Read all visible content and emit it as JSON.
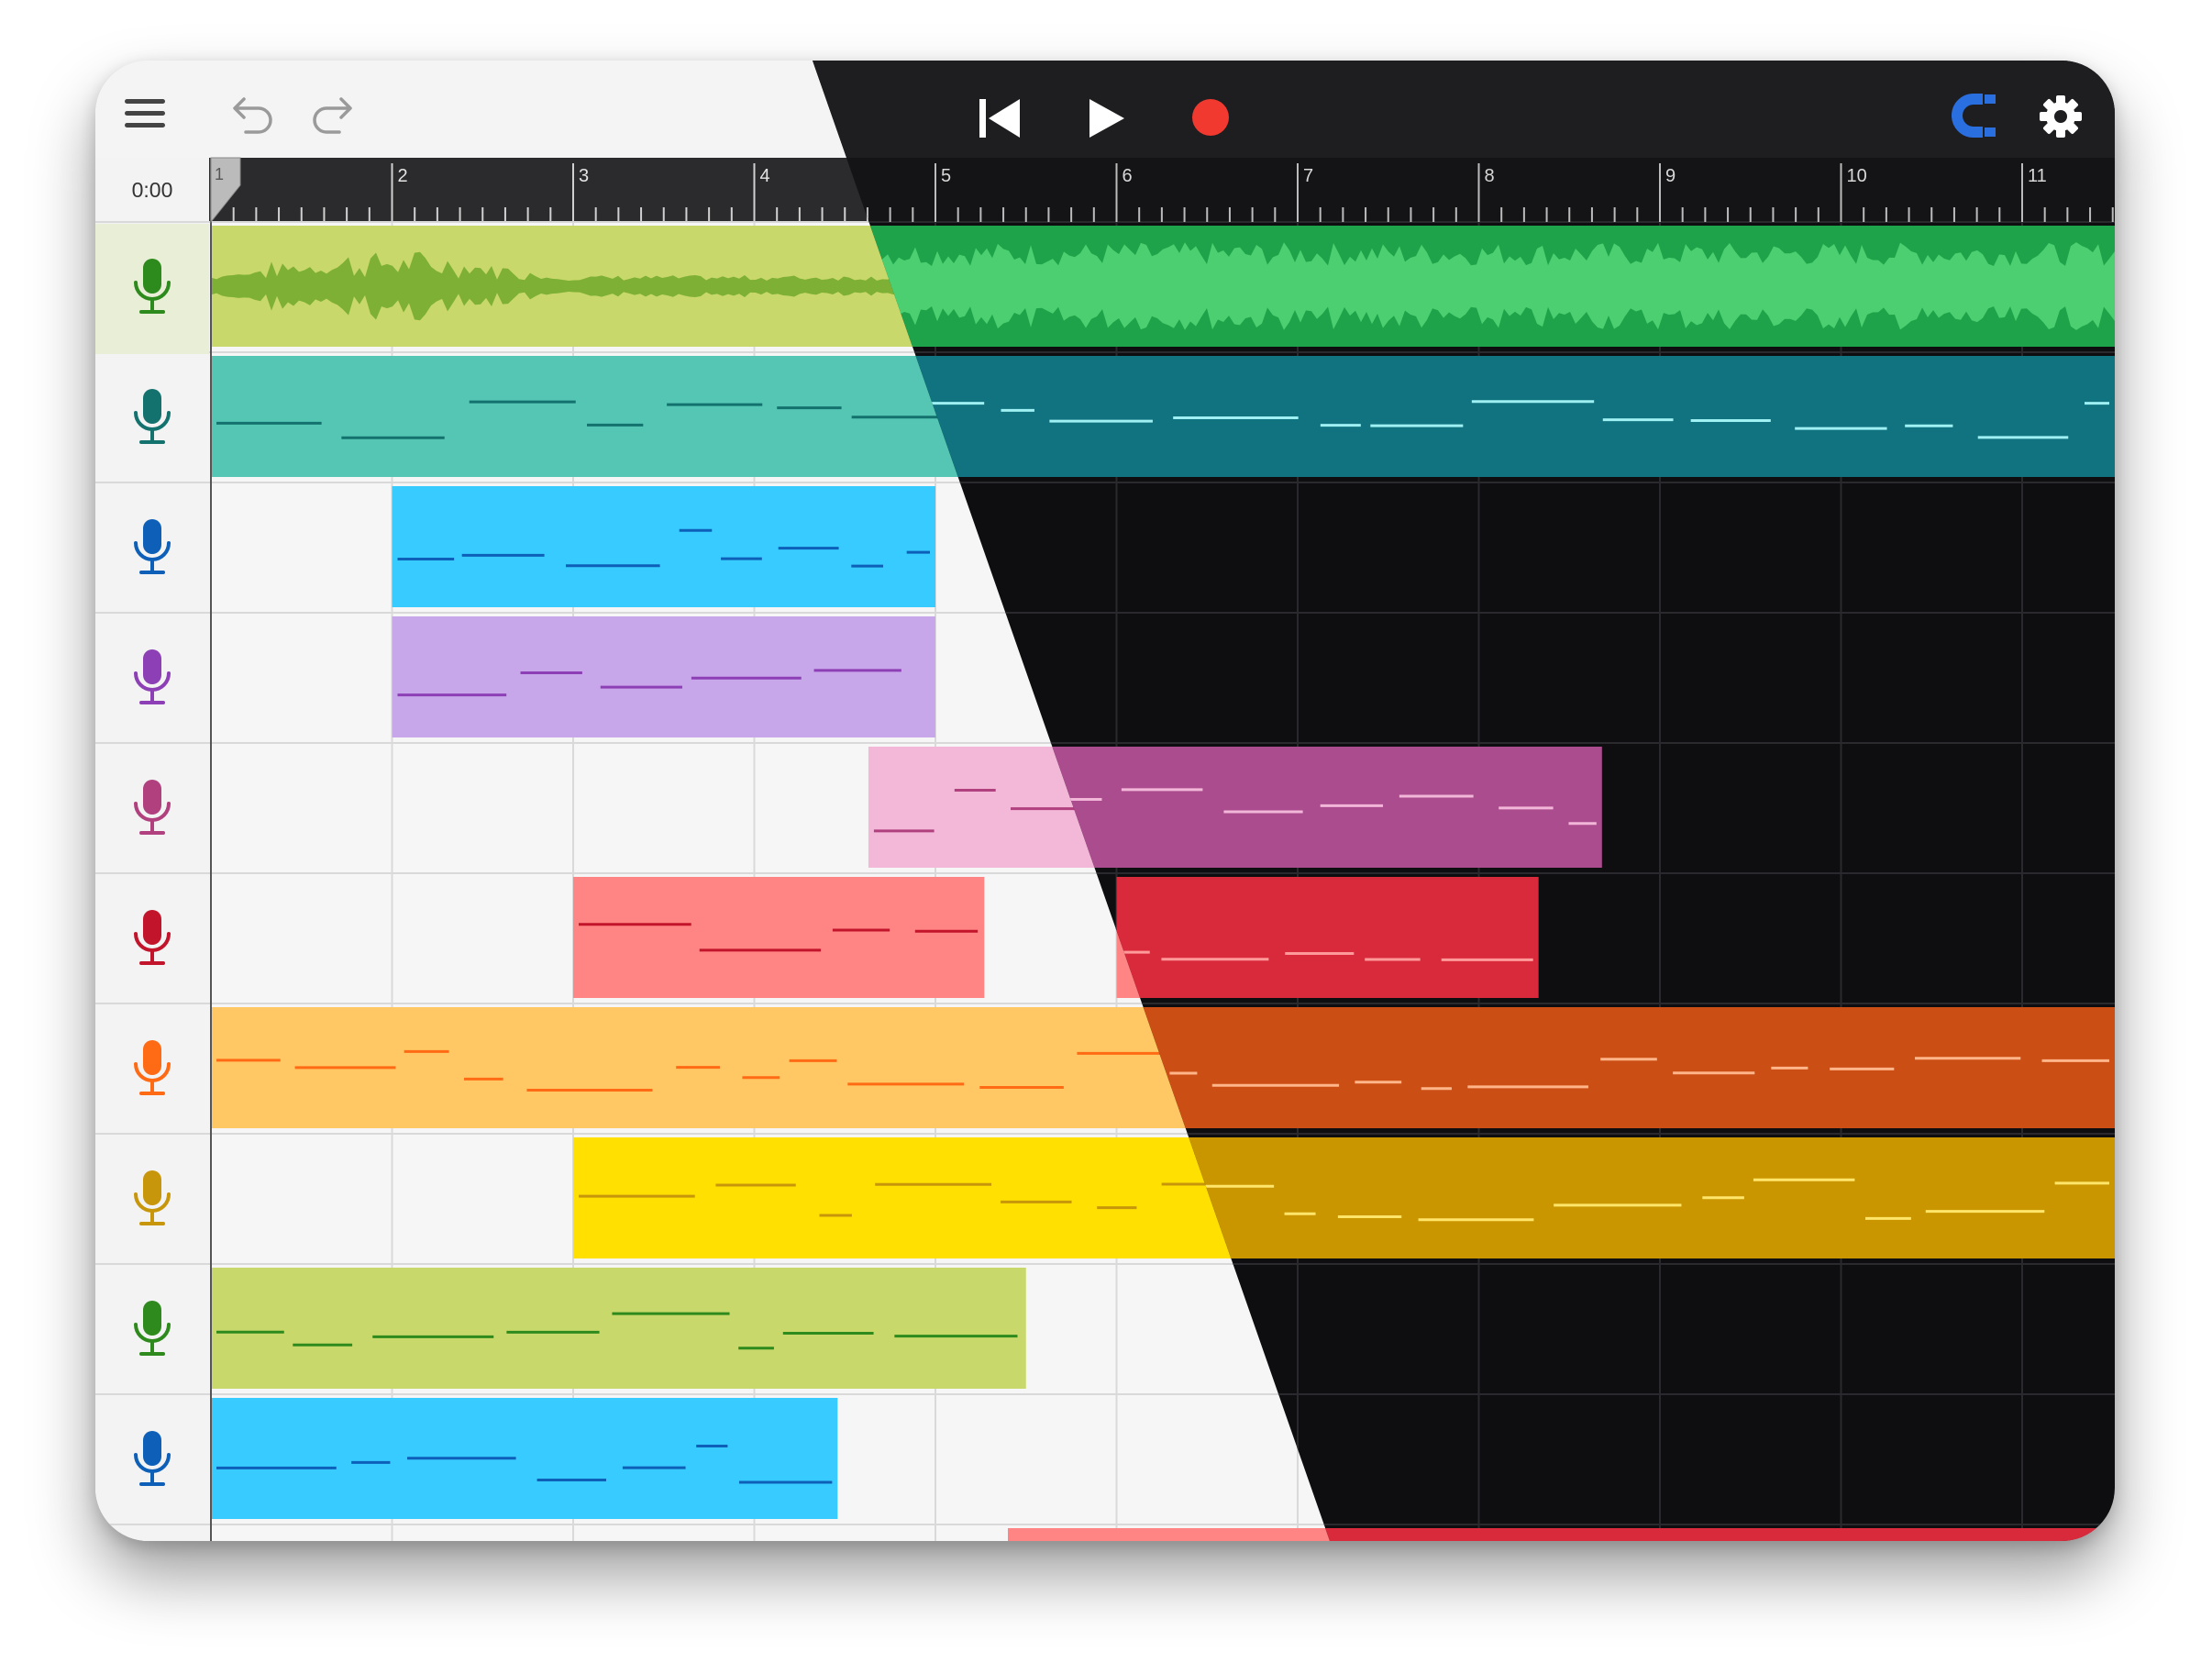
{
  "window_title": "",
  "toolbar": {
    "menu_icon": "hamburger-menu-icon",
    "undo_icon": "undo-arrow-icon",
    "redo_icon": "redo-arrow-icon",
    "rewind_icon": "skip-to-start-icon",
    "play_icon": "play-icon",
    "record_icon": "record-icon",
    "snap_icon": "magnet-snap-icon",
    "settings_icon": "gear-icon"
  },
  "time_readout": "0:00",
  "ruler": {
    "bar_labels": [
      "1",
      "2",
      "3",
      "4",
      "5",
      "6",
      "7",
      "8",
      "9",
      "10",
      "11"
    ],
    "playhead_bar": "1"
  },
  "tracks": [
    {
      "id": "track-1",
      "icon": "microphone-icon",
      "color": "#2d8a1c",
      "light_fill": "#c8d86a",
      "dark_fill": "#1ea34a",
      "selected": true
    },
    {
      "id": "track-2",
      "icon": "microphone-icon",
      "color": "#13726e",
      "light_fill": "#55c6b4",
      "dark_fill": "#11737f"
    },
    {
      "id": "track-3",
      "icon": "microphone-icon",
      "color": "#0d5fb8",
      "light_fill": "#38cbff",
      "dark_fill": "#0a6aa8"
    },
    {
      "id": "track-4",
      "icon": "microphone-icon",
      "color": "#8d3fb5",
      "light_fill": "#c8a6ea",
      "dark_fill": "#7a3ea0"
    },
    {
      "id": "track-5",
      "icon": "microphone-icon",
      "color": "#b0407e",
      "light_fill": "#f3b8d8",
      "dark_fill": "#ab4c8e"
    },
    {
      "id": "track-6",
      "icon": "microphone-icon",
      "color": "#c2142a",
      "light_fill": "#ff8484",
      "dark_fill": "#d92a3c"
    },
    {
      "id": "track-7",
      "icon": "microphone-icon",
      "color": "#ff6a14",
      "light_fill": "#ffc864",
      "dark_fill": "#cb4e14"
    },
    {
      "id": "track-8",
      "icon": "microphone-icon",
      "color": "#c8960a",
      "light_fill": "#ffe000",
      "dark_fill": "#c99600"
    },
    {
      "id": "track-9",
      "icon": "microphone-icon",
      "color": "#2e8a1c",
      "light_fill": "#c8d86a",
      "dark_fill": "#3a9a2a"
    },
    {
      "id": "track-10",
      "icon": "microphone-icon",
      "color": "#0d5fb8",
      "light_fill": "#38cbff",
      "dark_fill": "#0a6aa8"
    }
  ],
  "theme": {
    "light_bg": "#f6f6f6",
    "light_toolbar": "#f4f4f4",
    "dark_bg": "#0e0e10",
    "dark_toolbar": "#1e1e20",
    "ruler_bg": "#2b2b2d",
    "record_color": "#f2392f",
    "snap_color": "#2a6fe0"
  }
}
